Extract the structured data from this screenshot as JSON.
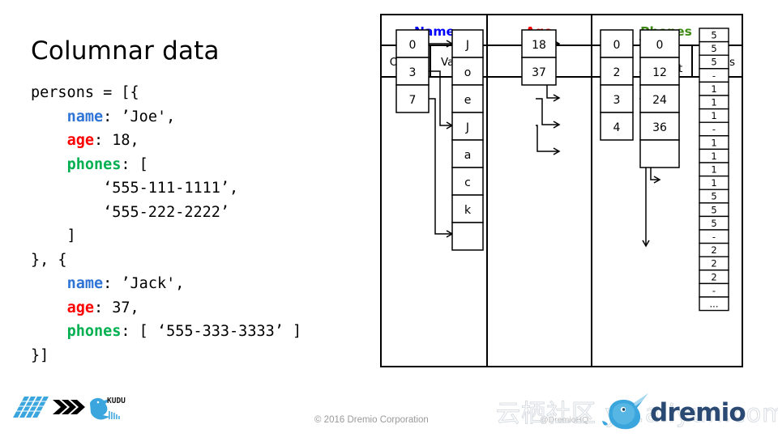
{
  "slide": {
    "title": "Columnar data"
  },
  "code": {
    "lines": [
      [
        {
          "t": "persons = [{",
          "c": "plain"
        }
      ],
      [
        {
          "t": "    ",
          "c": "plain"
        },
        {
          "t": "name",
          "c": "k-name"
        },
        {
          "t": ": ’Joe',",
          "c": "plain"
        }
      ],
      [
        {
          "t": "    ",
          "c": "plain"
        },
        {
          "t": "age",
          "c": "k-age"
        },
        {
          "t": ": 18,",
          "c": "plain"
        }
      ],
      [
        {
          "t": "    ",
          "c": "plain"
        },
        {
          "t": "phones",
          "c": "k-phones"
        },
        {
          "t": ": [",
          "c": "plain"
        }
      ],
      [
        {
          "t": "        ‘555-111-1111’,",
          "c": "plain"
        }
      ],
      [
        {
          "t": "        ‘555-222-2222’",
          "c": "plain"
        }
      ],
      [
        {
          "t": "    ]",
          "c": "plain"
        }
      ],
      [
        {
          "t": "}, {",
          "c": "plain"
        }
      ],
      [
        {
          "t": "    ",
          "c": "plain"
        },
        {
          "t": "name",
          "c": "k-name"
        },
        {
          "t": ": ’Jack',",
          "c": "plain"
        }
      ],
      [
        {
          "t": "    ",
          "c": "plain"
        },
        {
          "t": "age",
          "c": "k-age"
        },
        {
          "t": ": 37,",
          "c": "plain"
        }
      ],
      [
        {
          "t": "    ",
          "c": "plain"
        },
        {
          "t": "phones",
          "c": "k-phones"
        },
        {
          "t": ": [ ‘555-333-3333’ ]",
          "c": "plain"
        }
      ],
      [
        {
          "t": "}]",
          "c": "plain"
        }
      ]
    ]
  },
  "diagram": {
    "group_headers": [
      {
        "label": "Name",
        "color": "#0000ff"
      },
      {
        "label": "Age",
        "color": "#ff0000"
      },
      {
        "label": "Phones",
        "color": "#3e8b12"
      }
    ],
    "sub_headers": [
      {
        "label": "Offset"
      },
      {
        "label": "Values"
      },
      {
        "label": "Values"
      },
      {
        "label": "List\nOffset",
        "line1": "List",
        "line2": "Offset"
      },
      {
        "label": "Str.\nOffset",
        "line1": "Str.",
        "line2": "Offset"
      },
      {
        "label": "Values"
      }
    ],
    "name_offset_cells": [
      "0",
      "3",
      "7"
    ],
    "name_value_cells": [
      "J",
      "o",
      "e",
      "J",
      "a",
      "c",
      "k",
      ""
    ],
    "age_value_cells": [
      "18",
      "37"
    ],
    "phones_list_offset_cells": [
      "0",
      "2",
      "3",
      "4"
    ],
    "phones_str_offset_cells": [
      "0",
      "12",
      "24",
      "36",
      ""
    ],
    "phones_value_cells": [
      "5",
      "5",
      "5",
      "-",
      "1",
      "1",
      "1",
      "-",
      "1",
      "1",
      "1",
      "1",
      "5",
      "5",
      "5",
      "-",
      "2",
      "2",
      "2",
      "-",
      "..."
    ]
  },
  "footer": {
    "copyright": "© 2016 Dremio Corporation",
    "twitter_handle": "@DremioHQ",
    "watermark": "云栖社区 yq.aliyun.com",
    "brand_name": "dremio",
    "kudu_label": "KUDU",
    "accent_blue": "#3aa6dd",
    "brand_navy": "#2b4a73"
  }
}
